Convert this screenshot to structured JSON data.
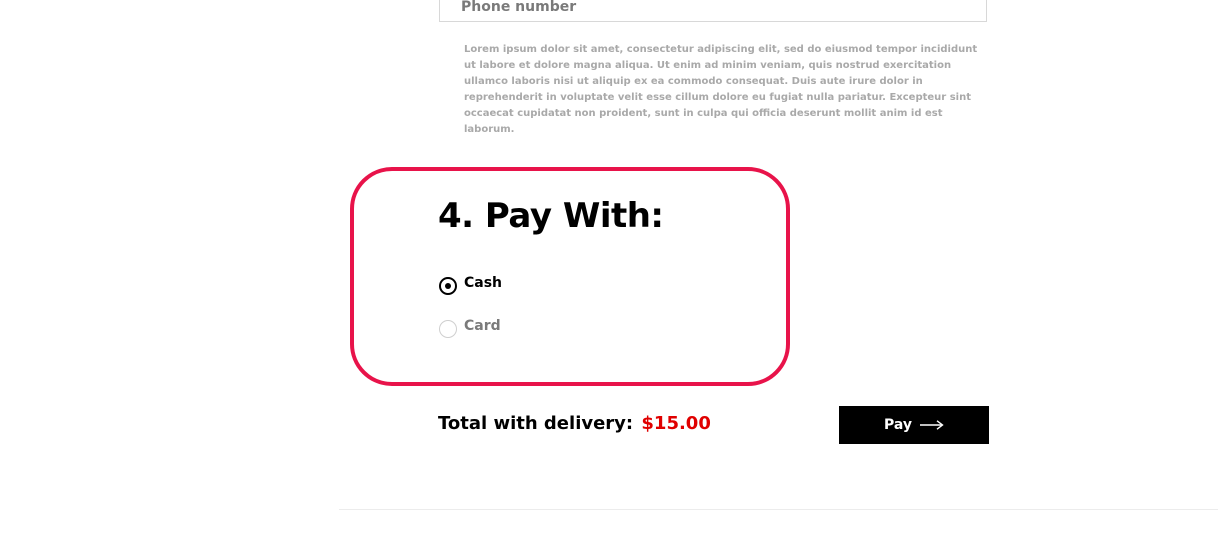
{
  "contact": {
    "phone_placeholder": "Phone number",
    "note": "Lorem ipsum dolor sit amet, consectetur adipiscing elit, sed do eiusmod tempor incididunt ut labore et dolore magna aliqua. Ut enim ad minim veniam, quis nostrud exercitation ullamco laboris nisi ut aliquip ex ea commodo consequat. Duis aute irure dolor in reprehenderit in voluptate velit esse cillum dolore eu fugiat nulla pariatur. Excepteur sint occaecat cupidatat non proident, sunt in culpa qui officia deserunt mollit anim id est laborum."
  },
  "payment": {
    "title": "4. Pay With:",
    "selected": "Cash",
    "options": [
      {
        "label": "Cash",
        "checked": true
      },
      {
        "label": "Card",
        "checked": false
      }
    ],
    "highlight_color": "#e8134a"
  },
  "summary": {
    "total_label": "Total with delivery:",
    "total_amount": "$15.00",
    "amount_color": "#e00000"
  },
  "actions": {
    "pay_label": "Pay",
    "pay_icon": "arrow-right-icon"
  }
}
